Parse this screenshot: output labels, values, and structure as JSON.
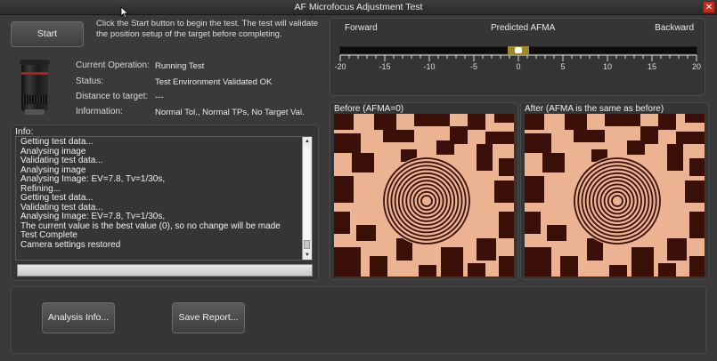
{
  "window": {
    "title": "AF Microfocus Adjustment Test",
    "close_glyph": "✕"
  },
  "start_button": {
    "label": "Start"
  },
  "instructions": "Click the Start button to begin the test.  The test will validate the position setup of the target before completing.",
  "lens_image": {
    "icon": "camera-lens-icon"
  },
  "status_fields": [
    {
      "label": "Current Operation:",
      "value": "Running Test"
    },
    {
      "label": "Status:",
      "value": "Test Environment Validated OK"
    },
    {
      "label": "Distance to target:",
      "value": "---"
    },
    {
      "label": "Information:",
      "value": "Normal Tol., Normal TPs, No Target Val."
    }
  ],
  "info": {
    "title": "Info:",
    "log_lines": [
      "Getting test data...",
      "Analysing image",
      "Validating test data...",
      "Analysing image",
      "Analysing Image: EV=7.8, Tv=1/30s,",
      "Refining...",
      "Getting test data...",
      "Validating test data...",
      "Analysing Image: EV=7.8, Tv=1/30s,",
      "The current value is the best value (0), so no change will be made",
      "Test Complete",
      "Camera settings restored"
    ]
  },
  "bottom_buttons": {
    "analysis_info": "Analysis Info...",
    "save_report": "Save Report..."
  },
  "afma": {
    "forward_label": "Forward",
    "predicted_label": "Predicted AFMA",
    "backward_label": "Backward",
    "predicted_value": 0,
    "range": [
      -20,
      20
    ],
    "tick_labels": [
      "-20",
      "-15",
      "-10",
      "-5",
      "0",
      "5",
      "10",
      "15",
      "20"
    ],
    "bar_color": "#9c8a2a"
  },
  "before_panel": {
    "title": "Before (AFMA=0)"
  },
  "after_panel": {
    "title": "After (AFMA is the same as before)"
  },
  "colors": {
    "target_light": "#ecb393",
    "target_dark": "#3a1008",
    "close": "#c42b1c"
  }
}
